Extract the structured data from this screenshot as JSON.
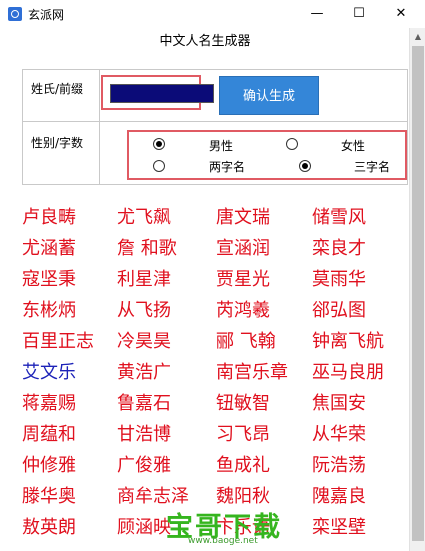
{
  "window": {
    "title": "玄派网",
    "controls": {
      "minimize": "—",
      "maximize": "☐",
      "close": "✕"
    },
    "app_icon": "app-logo-icon"
  },
  "form": {
    "title": "中文人名生成器",
    "surname_label": "姓氏/前缀",
    "surname_value": "",
    "confirm_label": "确认生成",
    "gender_label": "性别/字数",
    "options": {
      "male": {
        "label": "男性",
        "checked": true
      },
      "female": {
        "label": "女性",
        "checked": false
      },
      "two_char": {
        "label": "两字名",
        "checked": false
      },
      "three_char": {
        "label": "三字名",
        "checked": true
      }
    }
  },
  "colors": {
    "red_name": "#e0101e",
    "blue_name": "#1c22b8",
    "button": "#3486d8",
    "highlight": "#e05a63"
  },
  "names": [
    [
      {
        "text": "卢良畴",
        "color": "red"
      },
      {
        "text": "尤飞飙",
        "color": "red"
      },
      {
        "text": "唐文瑞",
        "color": "red"
      },
      {
        "text": "储雪风",
        "color": "red"
      }
    ],
    [
      {
        "text": "尤涵蓄",
        "color": "red"
      },
      {
        "text": "詹 和歌",
        "color": "red"
      },
      {
        "text": "宣涵润",
        "color": "red"
      },
      {
        "text": "栾良才",
        "color": "red"
      }
    ],
    [
      {
        "text": "寇坚秉",
        "color": "red"
      },
      {
        "text": "利星津",
        "color": "red"
      },
      {
        "text": "贾星光",
        "color": "red"
      },
      {
        "text": "莫雨华",
        "color": "red"
      }
    ],
    [
      {
        "text": "东彬炳",
        "color": "red"
      },
      {
        "text": "从飞扬",
        "color": "red"
      },
      {
        "text": "芮鸿羲",
        "color": "red"
      },
      {
        "text": "郤弘图",
        "color": "red"
      }
    ],
    [
      {
        "text": "百里正志",
        "color": "red"
      },
      {
        "text": "冷昊昊",
        "color": "red"
      },
      {
        "text": "郦 飞翰",
        "color": "red"
      },
      {
        "text": "钟离飞航",
        "color": "red"
      }
    ],
    [
      {
        "text": "艾文乐",
        "color": "blue"
      },
      {
        "text": "黄浩广",
        "color": "red"
      },
      {
        "text": "南宫乐章",
        "color": "red"
      },
      {
        "text": "巫马良朋",
        "color": "red"
      }
    ],
    [
      {
        "text": "蒋嘉赐",
        "color": "red"
      },
      {
        "text": "鲁嘉石",
        "color": "red"
      },
      {
        "text": "钮敏智",
        "color": "red"
      },
      {
        "text": "焦国安",
        "color": "red"
      }
    ],
    [
      {
        "text": "周蕴和",
        "color": "red"
      },
      {
        "text": "甘浩博",
        "color": "red"
      },
      {
        "text": "习飞昂",
        "color": "red"
      },
      {
        "text": "从华荣",
        "color": "red"
      }
    ],
    [
      {
        "text": "仲修雅",
        "color": "red"
      },
      {
        "text": "广俊雅",
        "color": "red"
      },
      {
        "text": "鱼成礼",
        "color": "red"
      },
      {
        "text": "阮浩荡",
        "color": "red"
      }
    ],
    [
      {
        "text": "滕华奥",
        "color": "red"
      },
      {
        "text": "商牟志泽",
        "color": "red"
      },
      {
        "text": "魏阳秋",
        "color": "red"
      },
      {
        "text": "隗嘉良",
        "color": "red"
      }
    ],
    [
      {
        "text": "敖英朗",
        "color": "red"
      },
      {
        "text": "顾涵映",
        "color": "red"
      },
      {
        "text": "卞乐语",
        "color": "red"
      },
      {
        "text": "栾坚壁",
        "color": "red"
      }
    ]
  ],
  "watermark": {
    "text": "宝哥下载",
    "url": "www.baoge.net"
  }
}
